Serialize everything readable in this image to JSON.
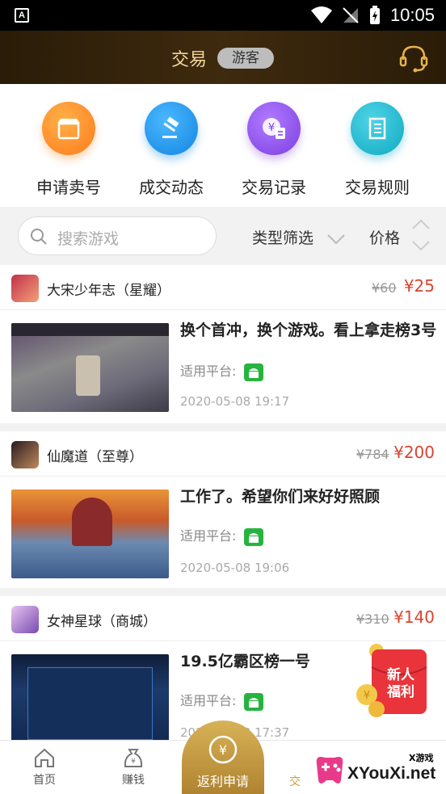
{
  "status": {
    "time": "10:05"
  },
  "header": {
    "title": "交易",
    "badge": "游客"
  },
  "quick_actions": [
    {
      "label": "申请卖号",
      "icon": "store-icon",
      "color": "#ff8a2a"
    },
    {
      "label": "成交动态",
      "icon": "gavel-icon",
      "color": "#1e90e8"
    },
    {
      "label": "交易记录",
      "icon": "receipt-yen-icon",
      "color": "#8a4fe0"
    },
    {
      "label": "交易规则",
      "icon": "document-icon",
      "color": "#19b3c9"
    }
  ],
  "filter": {
    "search_placeholder": "搜索游戏",
    "type_label": "类型筛选",
    "price_label": "价格"
  },
  "listings": [
    {
      "game": "大宋少年志（星耀）",
      "old_price": "¥60",
      "price": "¥25",
      "title": "换个首冲，换个游戏。看上拿走榜3号",
      "platform_label": "适用平台:",
      "platform": "android",
      "time": "2020-05-08 19:17"
    },
    {
      "game": "仙魔道（至尊）",
      "old_price": "¥784",
      "price": "¥200",
      "title": "工作了。希望你们来好好照顾",
      "platform_label": "适用平台:",
      "platform": "android",
      "time": "2020-05-08 19:06"
    },
    {
      "game": "女神星球（商城）",
      "old_price": "¥310",
      "price": "¥140",
      "title": "19.5亿霸区榜一号",
      "platform_label": "适用平台:",
      "platform": "android",
      "time": "2020-05-08 17:37"
    }
  ],
  "promo": {
    "line1": "新人",
    "line2": "福利"
  },
  "tabbar": {
    "home": "首页",
    "earn": "赚钱",
    "center": "返利申请",
    "trade_partial": "交"
  },
  "watermark": {
    "brand": "XYouXi.net",
    "small": "X游戏"
  }
}
